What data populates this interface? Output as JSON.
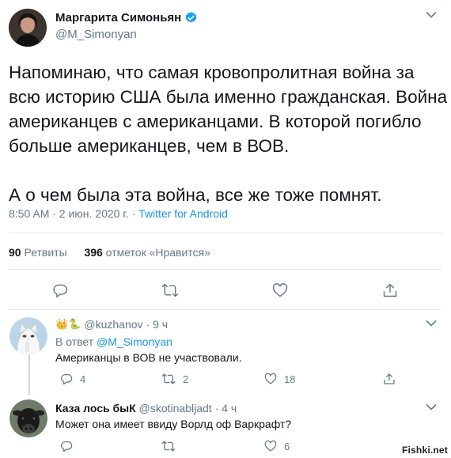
{
  "tweet": {
    "author_name": "Маргарита Симоньян",
    "author_handle": "@M_Simonyan",
    "text_lines": [
      "Напоминаю, что самая кровопролитная война за",
      "всю историю США была именно гражданская. Война",
      "американцев с американцами. В которой погибло",
      "больше американцев, чем в ВОВ.",
      "А о чем была эта война, все же тоже помнят."
    ],
    "time": "8:50 AM · 2 июн. 2020 г. · ",
    "source": "Twitter for Android",
    "retweets_count": "90",
    "retweets_label": " Ретвиты",
    "likes_count": "396",
    "likes_label": " отметок «Нравится»"
  },
  "replies": [
    {
      "emoji_prefix": "👑🐍",
      "handle": "@kuzhanov",
      "age": "· 9 ч",
      "reply_to_label": "В ответ ",
      "reply_to_handle": "@M_Simonyan",
      "text": "Американцы в ВОВ не участвовали.",
      "reply_count": "4",
      "retweet_count": "2",
      "like_count": "18"
    },
    {
      "name": "Каза лось быК",
      "handle": "@skotinabljadt",
      "age": "· 4 ч",
      "text": "Может она имеет ввиду Ворлд оф Варкрафт?",
      "like_count": "6"
    }
  ],
  "watermark": "Fishki.net",
  "icons": [
    "verified-badge-icon",
    "chevron-down-icon",
    "reply-icon",
    "retweet-icon",
    "like-icon",
    "share-icon"
  ],
  "colors": {
    "accent": "#1b95e0",
    "muted": "#657786",
    "text": "#14171a",
    "divider": "#e1e8ed"
  }
}
